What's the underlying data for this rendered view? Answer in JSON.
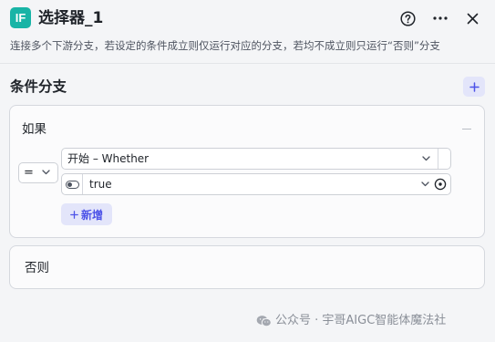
{
  "node": {
    "icon_text": "IF",
    "title": "选择器_1",
    "description": "连接多个下游分支，若设定的条件成立则仅运行对应的分支，若均不成立则只运行“否则”分支"
  },
  "header_actions": {
    "help_icon": "help-circle-icon",
    "more_icon": "more-horizontal-icon",
    "close_icon": "close-icon"
  },
  "section": {
    "title": "条件分支",
    "add_icon": "plus-icon"
  },
  "if_branch": {
    "label": "如果",
    "condition": {
      "operator": "=",
      "left_value": "开始 – Whether",
      "right_value": "true"
    },
    "add_condition_label": "新增"
  },
  "else_branch": {
    "label": "否则"
  },
  "watermark": {
    "icon": "wechat-icon",
    "text": "公众号 · 宇哥AIGC智能体魔法社"
  },
  "colors": {
    "accent": "#4d53e8",
    "accent_bg": "#e3e5fa",
    "node_icon_bg": "#18b4a6",
    "panel_bg": "#f4f5f7"
  }
}
